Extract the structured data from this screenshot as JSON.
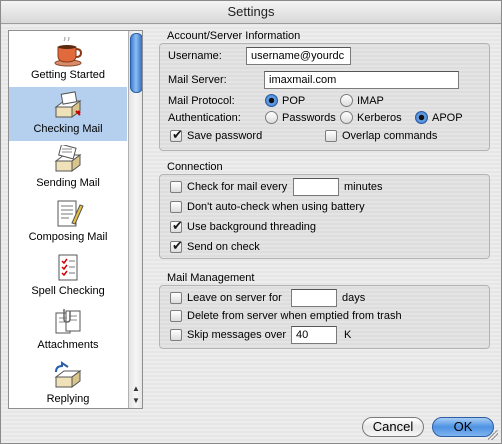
{
  "window": {
    "title": "Settings"
  },
  "sidebar": {
    "items": [
      {
        "label": "Getting Started",
        "icon": "coffee-cup-icon",
        "selected": false
      },
      {
        "label": "Checking Mail",
        "icon": "mailbox-tray-icon",
        "selected": true
      },
      {
        "label": "Sending Mail",
        "icon": "outbox-tray-icon",
        "selected": false
      },
      {
        "label": "Composing Mail",
        "icon": "compose-letter-icon",
        "selected": false
      },
      {
        "label": "Spell Checking",
        "icon": "spell-check-list-icon",
        "selected": false
      },
      {
        "label": "Attachments",
        "icon": "paperclip-documents-icon",
        "selected": false
      },
      {
        "label": "Replying",
        "icon": "reply-envelope-icon",
        "selected": false
      }
    ]
  },
  "account": {
    "title": "Account/Server Information",
    "username_label": "Username:",
    "username_value": "username@yourdc",
    "mailserver_label": "Mail Server:",
    "mailserver_value": "imaxmail.com",
    "protocol_label": "Mail Protocol:",
    "protocol_options": [
      "POP",
      "IMAP"
    ],
    "protocol_selected": "POP",
    "auth_label": "Authentication:",
    "auth_options": [
      "Passwords",
      "Kerberos",
      "APOP"
    ],
    "auth_selected": "APOP",
    "save_password_label": "Save password",
    "save_password_checked": true,
    "overlap_label": "Overlap commands",
    "overlap_checked": false
  },
  "connection": {
    "title": "Connection",
    "check_every_label": "Check for mail every",
    "check_every_value": "",
    "minutes_label": "minutes",
    "dont_autocheck_label": "Don't auto-check when using battery",
    "background_threading_label": "Use background threading",
    "send_on_check_label": "Send on check"
  },
  "management": {
    "title": "Mail Management",
    "leave_on_server_label": "Leave on server for",
    "leave_on_server_value": "",
    "days_label": "days",
    "delete_from_server_label": "Delete from server when emptied from trash",
    "skip_messages_label": "Skip messages over",
    "skip_messages_value": "40",
    "k_label": "K"
  },
  "buttons": {
    "cancel": "Cancel",
    "ok": "OK"
  },
  "colors": {
    "selection": "#b5d0ef",
    "accent": "#3b7fd8"
  }
}
